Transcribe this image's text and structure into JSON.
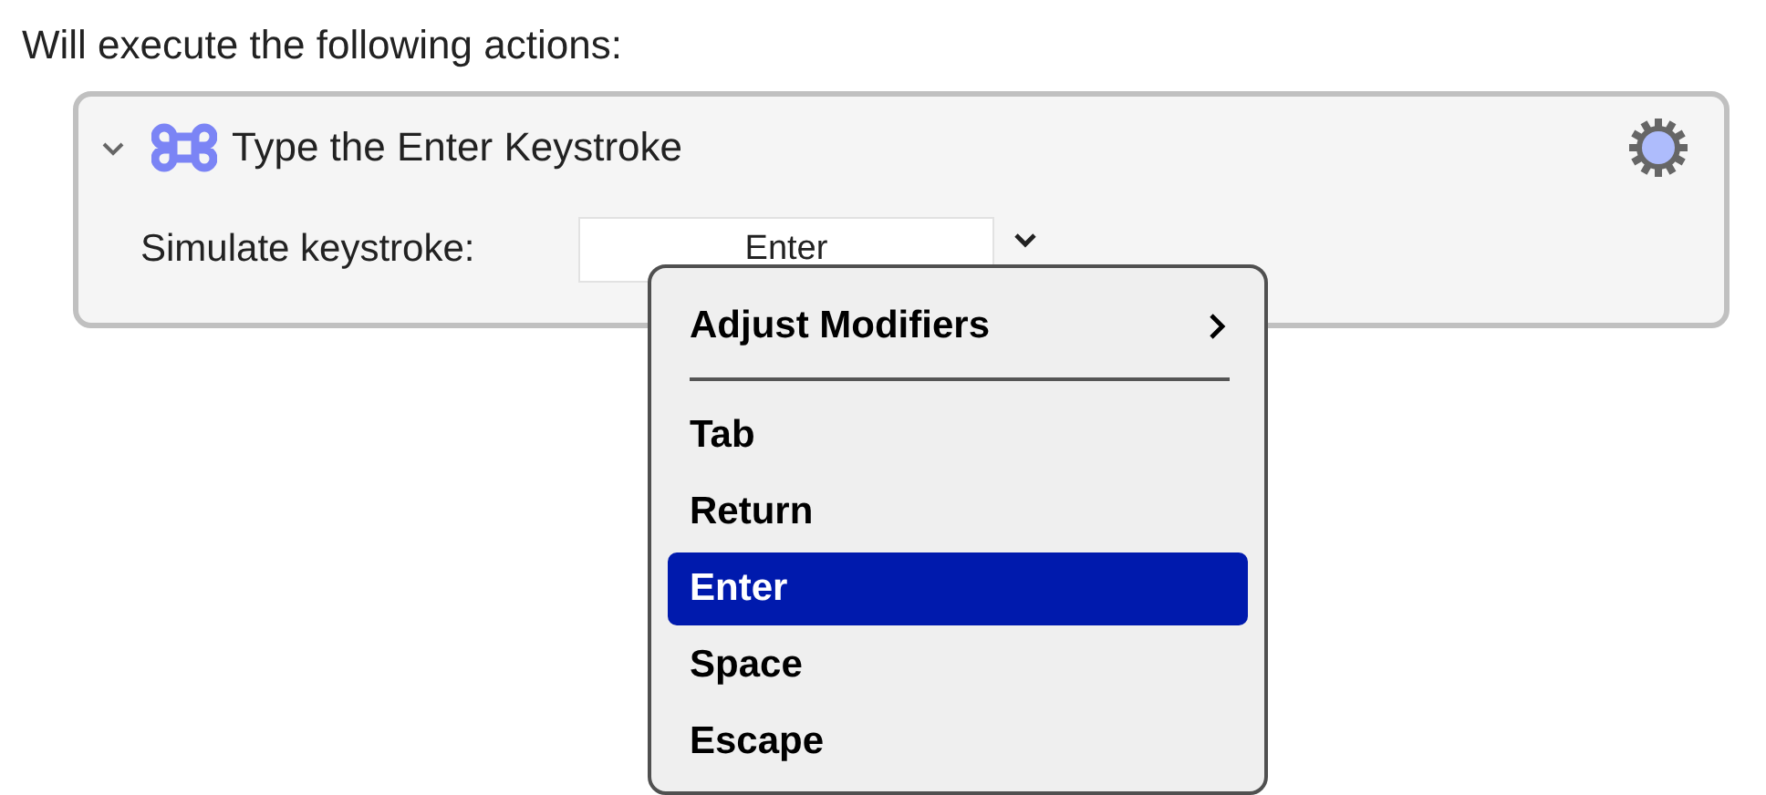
{
  "heading": "Will execute the following actions:",
  "action": {
    "title": "Type the Enter Keystroke",
    "expanded": true,
    "field_label": "Simulate keystroke:",
    "field_value": "Enter"
  },
  "menu": {
    "submenu": "Adjust Modifiers",
    "items": [
      {
        "label": "Tab",
        "selected": false
      },
      {
        "label": "Return",
        "selected": false
      },
      {
        "label": "Enter",
        "selected": true
      },
      {
        "label": "Space",
        "selected": false
      },
      {
        "label": "Escape",
        "selected": false
      }
    ]
  }
}
